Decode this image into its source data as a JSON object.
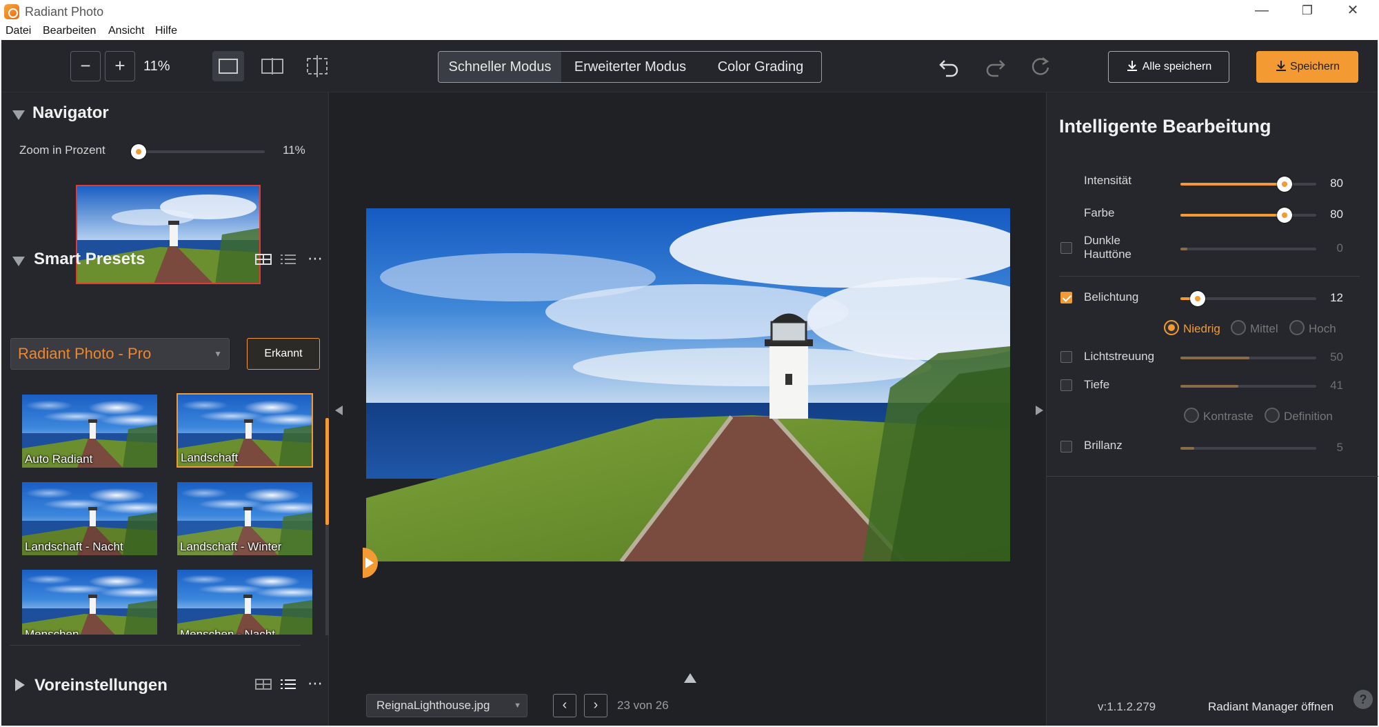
{
  "window": {
    "title": "Radiant Photo",
    "minimize": "—",
    "restore": "❐",
    "close": "✕"
  },
  "menu": [
    "Datei",
    "Bearbeiten",
    "Ansicht",
    "Hilfe"
  ],
  "toolbar": {
    "zoom_out": "−",
    "zoom_in": "+",
    "zoom_value": "11%",
    "modes": [
      "Schneller Modus",
      "Erweiterter Modus",
      "Color Grading"
    ],
    "active_mode": "Schneller Modus",
    "save_all": "Alle speichern",
    "save": "Speichern"
  },
  "navigator": {
    "title": "Navigator",
    "zoom_label": "Zoom in Prozent",
    "zoom_value": "11%",
    "zoom_fraction": 0.05
  },
  "smart_presets": {
    "title": "Smart Presets",
    "selected": "Radiant Photo - Pro",
    "detected_button": "Erkannt",
    "items": [
      "Auto Radiant",
      "Landschaft",
      "Landschaft - Nacht",
      "Landschaft - Winter",
      "Menschen",
      "Menschen - Nacht"
    ],
    "selected_item": "Landschaft"
  },
  "presets_section": {
    "title": "Voreinstellungen"
  },
  "center": {
    "file_name": "ReignaLighthouse.jpg",
    "counter": "23 von 26",
    "prev": "‹",
    "next": "›"
  },
  "right": {
    "title": "Intelligente Bearbeitung",
    "sliders": {
      "intensitaet": {
        "label": "Intensität",
        "value": "80"
      },
      "farbe": {
        "label": "Farbe",
        "value": "80"
      },
      "dunkle": {
        "label": "Dunkle Hauttöne",
        "value": "0"
      },
      "belichtung": {
        "label": "Belichtung",
        "value": "12"
      },
      "lichtstreuung": {
        "label": "Lichtstreuung",
        "value": "50"
      },
      "tiefe": {
        "label": "Tiefe",
        "value": "41"
      },
      "brillanz": {
        "label": "Brillanz",
        "value": "5"
      }
    },
    "exposure_modes": [
      "Niedrig",
      "Mittel",
      "Hoch"
    ],
    "depth_modes": [
      "Kontraste",
      "Definition"
    ],
    "version": "v:1.1.2.279",
    "manager_link": "Radiant Manager öffnen",
    "help": "?"
  },
  "colors": {
    "accent": "#f39b32",
    "panel": "#25272c",
    "canvas": "#1f2125"
  }
}
